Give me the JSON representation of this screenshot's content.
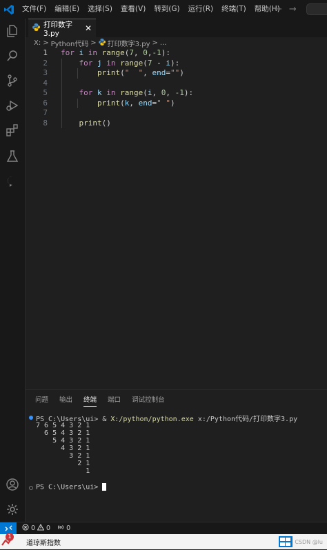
{
  "menu": [
    "文件(F)",
    "编辑(E)",
    "选择(S)",
    "查看(V)",
    "转到(G)",
    "运行(R)",
    "终端(T)",
    "帮助(H)"
  ],
  "nav": {
    "back": "←",
    "forward": "→"
  },
  "tab": {
    "filename": "打印数字3.py",
    "close": "✕"
  },
  "breadcrumb": {
    "drive": "X:",
    "sep1": ">",
    "folder": "Python代码",
    "sep2": ">",
    "file": "打印数字3.py",
    "sep3": ">",
    "more": "..."
  },
  "editor": {
    "line_numbers": [
      "1",
      "2",
      "3",
      "4",
      "5",
      "6",
      "7",
      "8"
    ],
    "lines": [
      {
        "tokens": [
          {
            "t": "for",
            "c": "kw"
          },
          {
            "t": " "
          },
          {
            "t": "i",
            "c": "vr"
          },
          {
            "t": " "
          },
          {
            "t": "in",
            "c": "kw"
          },
          {
            "t": " "
          },
          {
            "t": "range",
            "c": "fn"
          },
          {
            "t": "("
          },
          {
            "t": "7",
            "c": "nm"
          },
          {
            "t": ", "
          },
          {
            "t": "0",
            "c": "nm"
          },
          {
            "t": ","
          },
          {
            "t": "-1",
            "c": "nm"
          },
          {
            "t": "):"
          }
        ]
      },
      {
        "tokens": [
          {
            "t": "    "
          },
          {
            "t": "for",
            "c": "kw"
          },
          {
            "t": " "
          },
          {
            "t": "j",
            "c": "vr"
          },
          {
            "t": " "
          },
          {
            "t": "in",
            "c": "kw"
          },
          {
            "t": " "
          },
          {
            "t": "range",
            "c": "fn"
          },
          {
            "t": "("
          },
          {
            "t": "7",
            "c": "nm"
          },
          {
            "t": " - "
          },
          {
            "t": "i",
            "c": "vr"
          },
          {
            "t": "):"
          }
        ]
      },
      {
        "tokens": [
          {
            "t": "        "
          },
          {
            "t": "print",
            "c": "fn"
          },
          {
            "t": "("
          },
          {
            "t": "\"  \"",
            "c": "st"
          },
          {
            "t": ", "
          },
          {
            "t": "end",
            "c": "vr"
          },
          {
            "t": "="
          },
          {
            "t": "\"\"",
            "c": "st"
          },
          {
            "t": ")"
          }
        ]
      },
      {
        "tokens": []
      },
      {
        "tokens": [
          {
            "t": "    "
          },
          {
            "t": "for",
            "c": "kw"
          },
          {
            "t": " "
          },
          {
            "t": "k",
            "c": "vr"
          },
          {
            "t": " "
          },
          {
            "t": "in",
            "c": "kw"
          },
          {
            "t": " "
          },
          {
            "t": "range",
            "c": "fn"
          },
          {
            "t": "("
          },
          {
            "t": "i",
            "c": "vr"
          },
          {
            "t": ", "
          },
          {
            "t": "0",
            "c": "nm"
          },
          {
            "t": ", "
          },
          {
            "t": "-1",
            "c": "nm"
          },
          {
            "t": "):"
          }
        ]
      },
      {
        "tokens": [
          {
            "t": "        "
          },
          {
            "t": "print",
            "c": "fn"
          },
          {
            "t": "("
          },
          {
            "t": "k",
            "c": "vr"
          },
          {
            "t": ", "
          },
          {
            "t": "end",
            "c": "vr"
          },
          {
            "t": "="
          },
          {
            "t": "\" \"",
            "c": "st"
          },
          {
            "t": ")"
          }
        ]
      },
      {
        "tokens": []
      },
      {
        "tokens": [
          {
            "t": "    "
          },
          {
            "t": "print",
            "c": "fn"
          },
          {
            "t": "()"
          }
        ]
      }
    ]
  },
  "panel_tabs": [
    "问题",
    "输出",
    "终端",
    "端口",
    "调试控制台"
  ],
  "active_panel_tab": "终端",
  "terminal": {
    "command_prompt": "PS C:\\Users\\ui> & ",
    "command_exe": "X:/python/python.exe",
    "command_arg": " x:/Python代码/打印数字3.py",
    "output": [
      "7 6 5 4 3 2 1 ",
      "  6 5 4 3 2 1 ",
      "    5 4 3 2 1 ",
      "      4 3 2 1 ",
      "        3 2 1 ",
      "          2 1 ",
      "            1 "
    ],
    "final_prompt": "PS C:\\Users\\ui> "
  },
  "status": {
    "errors": "0",
    "warnings": "0",
    "ports": "0"
  },
  "taskbar": {
    "app_title": "道琼斯指数",
    "badge": "1",
    "right_text": "CSDN @lu"
  },
  "colors": {
    "accent": "#0078d4",
    "background": "#1f1f1f",
    "keyword": "#c586c0",
    "function": "#dcdcaa",
    "number": "#b5cea8",
    "variable": "#9cdcfe",
    "string": "#ce9178",
    "exe_path": "#dcdcaa"
  }
}
